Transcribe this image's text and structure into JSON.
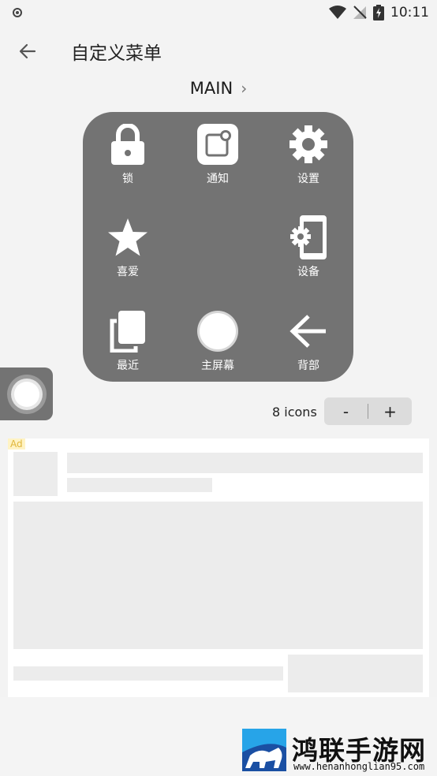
{
  "status_bar": {
    "time": "10:11"
  },
  "app_bar": {
    "title": "自定义菜单"
  },
  "menu": {
    "name": "MAIN",
    "chevron": "›"
  },
  "grid": {
    "items": [
      {
        "label": "锁",
        "icon": "lock-icon"
      },
      {
        "label": "通知",
        "icon": "notification-icon"
      },
      {
        "label": "设置",
        "icon": "gear-icon"
      },
      {
        "label": "喜爱",
        "icon": "star-icon"
      },
      {
        "label": "设备",
        "icon": "device-icon"
      },
      {
        "label": "最近",
        "icon": "recents-icon"
      },
      {
        "label": "主屏幕",
        "icon": "home-icon"
      },
      {
        "label": "背部",
        "icon": "back-arrow-icon"
      }
    ]
  },
  "icons_control": {
    "count_label": "8 icons",
    "minus": "-",
    "plus": "+"
  },
  "ad": {
    "badge": "Ad"
  },
  "watermark": {
    "text": "鸿联手游网",
    "url": "www.henanhonglian95.com"
  }
}
